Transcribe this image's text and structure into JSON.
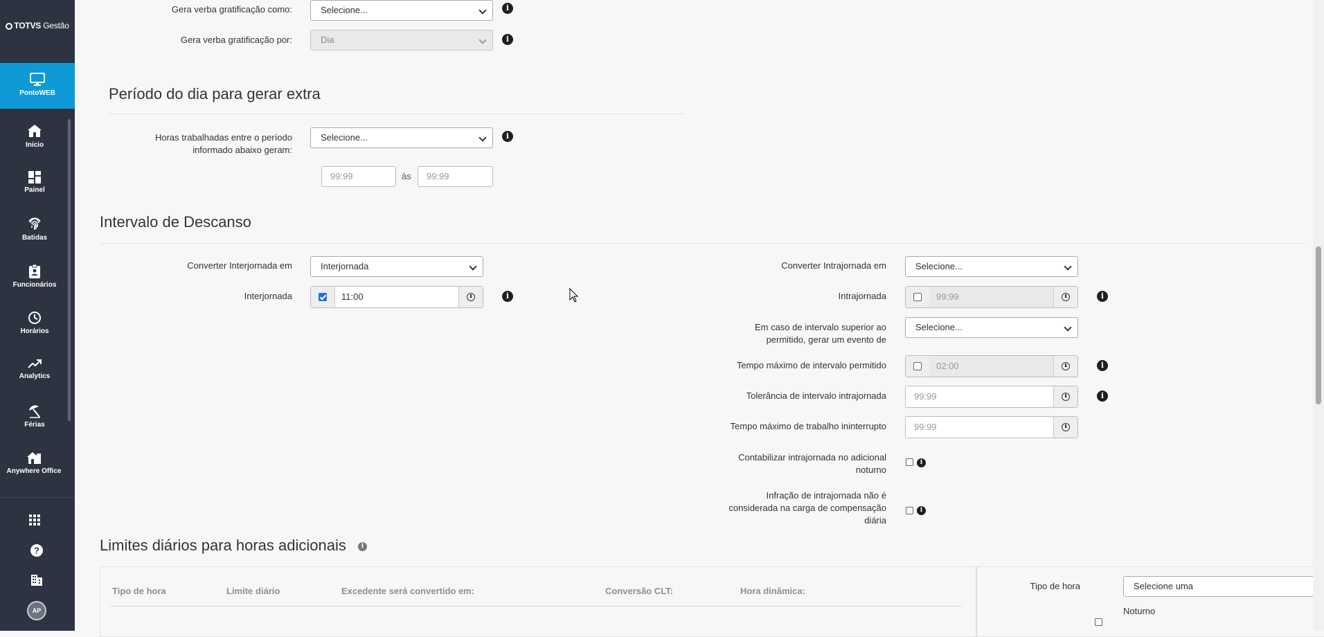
{
  "sidebar": {
    "brand": "TOTVS",
    "brand_suffix": " Gestão",
    "active": {
      "label": "PontoWEB",
      "icon": "monitor-icon"
    },
    "items": [
      {
        "label": "Início",
        "icon": "home-icon"
      },
      {
        "label": "Painel",
        "icon": "dashboard-icon"
      },
      {
        "label": "Batidas",
        "icon": "fingerprint-icon"
      },
      {
        "label": "Funcionários",
        "icon": "badge-icon"
      },
      {
        "label": "Horários",
        "icon": "clock-icon"
      },
      {
        "label": "Analytics",
        "icon": "trending-up-icon"
      },
      {
        "label": "Férias",
        "icon": "beach-umbrella-icon"
      },
      {
        "label": "Anywhere Office",
        "icon": "house-office-icon"
      }
    ],
    "bottom_icons": [
      "apps-grid-icon",
      "help-icon",
      "building-icon"
    ],
    "avatar_initials": "AP"
  },
  "top": {
    "gratificacao_como_label": "Gera verba gratificação como:",
    "gratificacao_como_value": "Selecione...",
    "gratificacao_por_label": "Gera verba gratificação por:",
    "gratificacao_por_value": "Dia"
  },
  "periodo": {
    "title": "Período do dia para gerar extra",
    "horas_label_1": "Horas trabalhadas entre o período",
    "horas_label_2": "informado abaixo geram:",
    "horas_value": "Selecione...",
    "from_placeholder": "99:99",
    "sep": "às",
    "to_placeholder": "99:99"
  },
  "intervalo": {
    "title": "Intervalo de Descanso",
    "converter_inter_label": "Converter Interjornada em",
    "converter_inter_value": "Interjornada",
    "interjornada_label": "Interjornada",
    "interjornada_value": "11:00",
    "interjornada_checked": true,
    "converter_intra_label": "Converter Intrajornada em",
    "converter_intra_value": "Selecione...",
    "intrajornada_label": "Intrajornada",
    "intrajornada_value": "99:99",
    "em_caso_label_1": "Em caso de intervalo superior ao",
    "em_caso_label_2": "permitido, gerar um evento de",
    "em_caso_value": "Selecione...",
    "tempo_max_label": "Tempo máximo de intervalo permitido",
    "tempo_max_value": "02:00",
    "tolerancia_label": "Tolerância de intervalo intrajornada",
    "tolerancia_placeholder": "99:99",
    "trabalho_label": "Tempo máximo de trabalho ininterrupto",
    "trabalho_placeholder": "99:99",
    "contabilizar_label_1": "Contabilizar intrajornada no adicional",
    "contabilizar_label_2": "noturno",
    "infracao_label_1": "Infração de intrajornada não é",
    "infracao_label_2": "considerada na carga de compensação",
    "infracao_label_3": "diária"
  },
  "limites": {
    "title": "Limites diários para horas adicionais",
    "columns": [
      "Tipo de hora",
      "Limite diário",
      "Excedente será convertido em:",
      "Conversão CLT:",
      "Hora dinâmica:"
    ],
    "tipo_label": "Tipo de hora",
    "tipo_value": "Selecione uma",
    "noturno_label": "Noturno"
  },
  "info_glyph": "i"
}
